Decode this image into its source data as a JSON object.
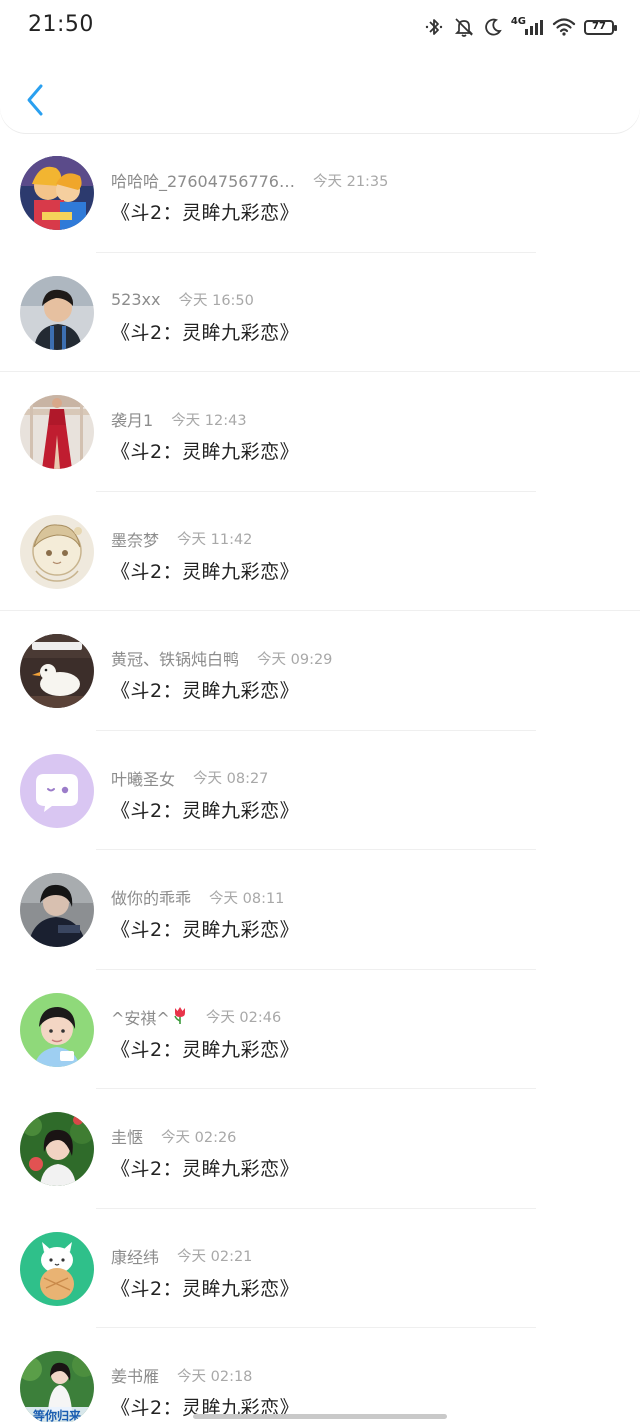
{
  "status_bar": {
    "time": "21:50",
    "network": "4G",
    "battery": "77",
    "icons": [
      "bluetooth-icon",
      "mute-icon",
      "moon-icon",
      "signal-icon",
      "wifi-icon",
      "battery-icon"
    ]
  },
  "header": {
    "back_icon": "chevron-left-icon",
    "accent_color": "#2aa0f0"
  },
  "messages": [
    {
      "name": "哈哈哈_27604756776…",
      "time": "今天 21:35",
      "text": "《斗2：灵眸九彩恋》",
      "avatar": "anime-couple-avatar"
    },
    {
      "name": "523xx",
      "time": "今天 16:50",
      "text": "《斗2：灵眸九彩恋》",
      "avatar": "boy-photo-avatar"
    },
    {
      "name": "袭月1",
      "time": "今天 12:43",
      "text": "《斗2：灵眸九彩恋》",
      "avatar": "red-dress-avatar"
    },
    {
      "name": "墨奈梦",
      "time": "今天 11:42",
      "text": "《斗2：灵眸九彩恋》",
      "avatar": "anime-girl-sketch-avatar"
    },
    {
      "name": "黄冠、铁锅炖白鸭",
      "time": "今天 09:29",
      "text": "《斗2：灵眸九彩恋》",
      "avatar": "duck-avatar"
    },
    {
      "name": "叶曦圣女",
      "time": "今天 08:27",
      "text": "《斗2：灵眸九彩恋》",
      "avatar": "default-chat-avatar"
    },
    {
      "name": "做你的乖乖",
      "time": "今天 08:11",
      "text": "《斗2：灵眸九彩恋》",
      "avatar": "dark-portrait-avatar"
    },
    {
      "name": "^安祺^",
      "time": "今天 02:46",
      "text": "《斗2：灵眸九彩恋》",
      "avatar": "boy-green-avatar"
    },
    {
      "name": "圭惬",
      "time": "今天 02:26",
      "text": "《斗2：灵眸九彩恋》",
      "avatar": "girl-leaves-avatar"
    },
    {
      "name": "康经纬",
      "time": "今天 02:21",
      "text": "《斗2：灵眸九彩恋》",
      "avatar": "cartoon-cat-avatar"
    },
    {
      "name": "姜书雁",
      "time": "今天 02:18",
      "text": "《斗2：灵眸九彩恋》",
      "avatar": "waiting-girl-avatar",
      "avatar_text": "等你归来"
    }
  ]
}
